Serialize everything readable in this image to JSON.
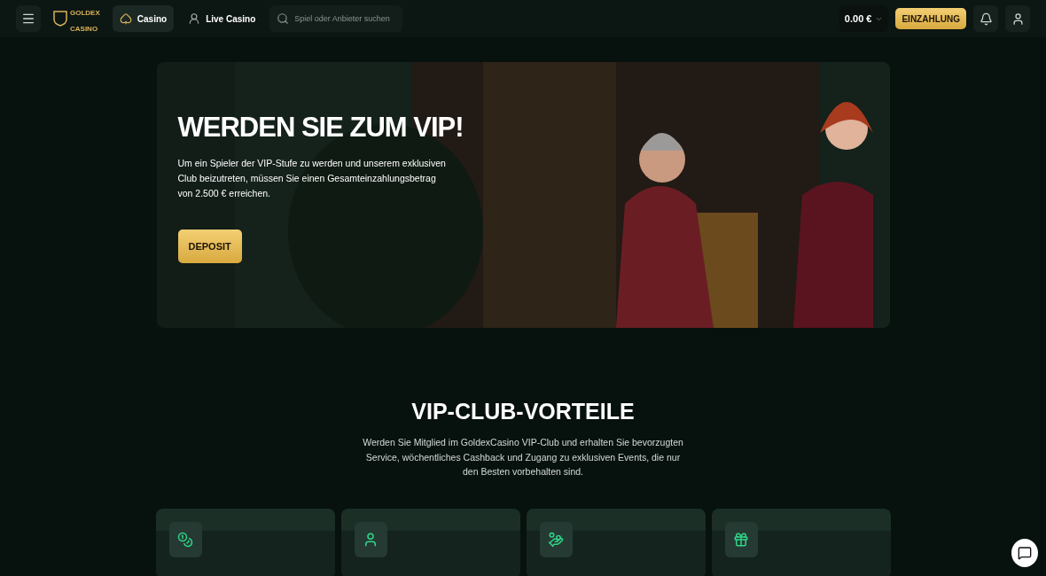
{
  "header": {
    "logo": {
      "line1": "GOLDEX",
      "line2": "CASINO"
    },
    "nav": [
      {
        "label": "Casino",
        "selected": true
      },
      {
        "label": "Live Casino",
        "selected": false
      }
    ],
    "search": {
      "placeholder": "Spiel oder Anbieter suchen"
    },
    "balance": "0.00 €",
    "deposit_button": "EINZAHLUNG"
  },
  "hero": {
    "title": "WERDEN SIE ZUM VIP!",
    "text": "Um ein Spieler der VIP-Stufe zu werden und unserem exklusiven Club beizutreten, müssen Sie einen Gesamteinzahlungsbetrag von 2.500 € erreichen.",
    "button": "DEPOSIT"
  },
  "benefits": {
    "title": "VIP-CLUB-VORTEILE",
    "text": "Werden Sie Mitglied im GoldexCasino VIP-Club und erhalten Sie bevorzugten Service, wöchentliches Cashback und Zugang zu exklusiven Events, die nur den Besten vorbehalten sind.",
    "cards": [
      {
        "kind": "coins"
      },
      {
        "kind": "person"
      },
      {
        "kind": "moneybag"
      },
      {
        "kind": "gift"
      }
    ]
  }
}
